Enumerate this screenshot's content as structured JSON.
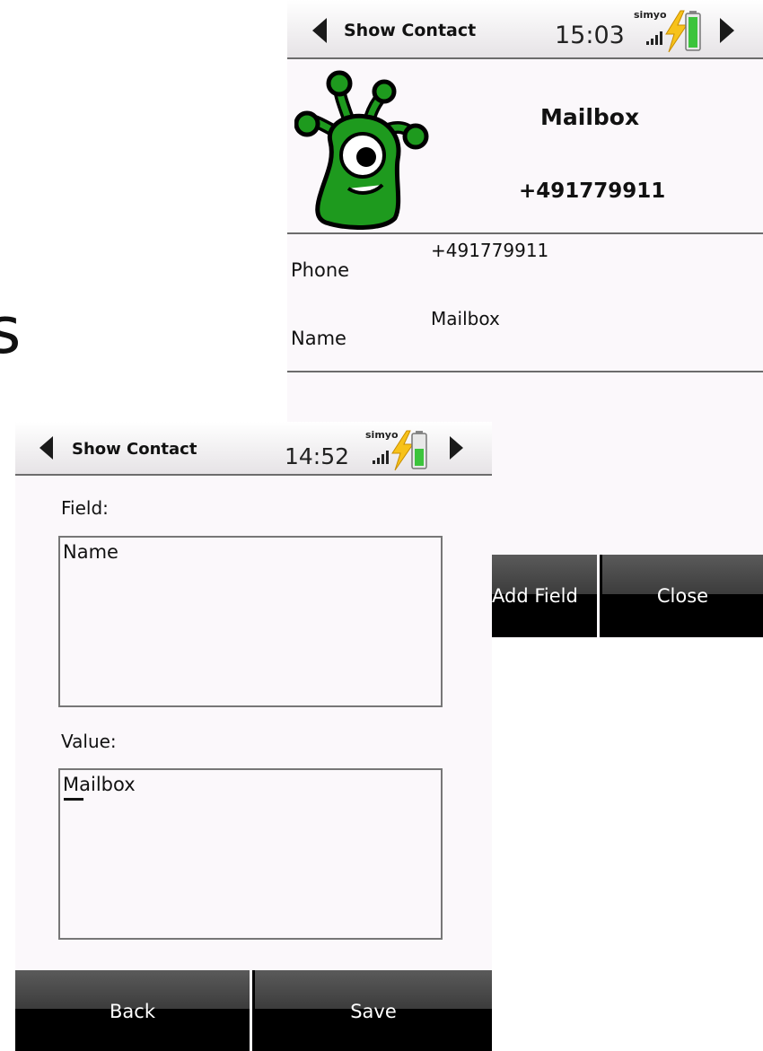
{
  "background": {
    "glyph": "s"
  },
  "back_screen": {
    "title": "Show Contact",
    "clock": "15:03",
    "carrier": "simyo",
    "contact": {
      "name": "Mailbox",
      "number": "+491779911"
    },
    "rows": [
      {
        "label": "Phone",
        "value": "+491779911"
      },
      {
        "label": "Name",
        "value": "Mailbox"
      }
    ],
    "buttons": {
      "add_field": "Add Field",
      "close": "Close"
    }
  },
  "front_screen": {
    "title": "Show Contact",
    "clock": "14:52",
    "carrier": "simyo",
    "field_label": "Field:",
    "field_value": "Name",
    "value_label": "Value:",
    "value_value": "Mailbox",
    "buttons": {
      "back": "Back",
      "save": "Save"
    }
  },
  "colors": {
    "battery_green": "#3cc43c",
    "bolt_yellow": "#f7c21a",
    "avatar_green": "#1e9a1e"
  },
  "icons": [
    "back-arrow-icon",
    "forward-arrow-icon",
    "signal-icon",
    "charging-bolt-icon",
    "battery-icon"
  ]
}
